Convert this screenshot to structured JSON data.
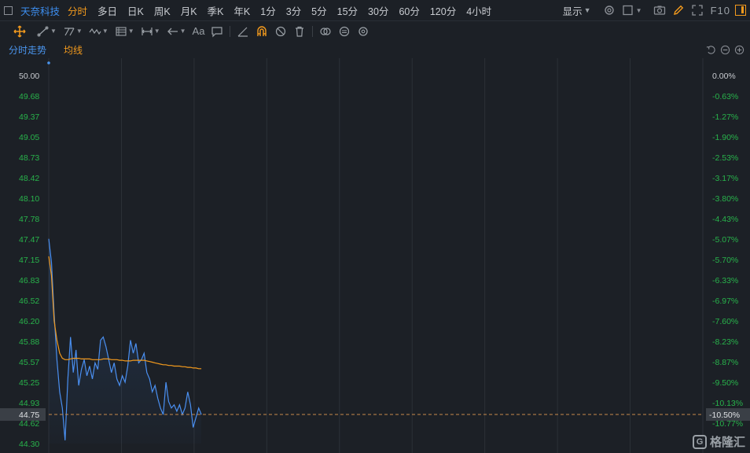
{
  "header": {
    "stock_name": "天奈科技",
    "periods": [
      "分时",
      "多日",
      "日K",
      "周K",
      "月K",
      "季K",
      "年K",
      "1分",
      "3分",
      "5分",
      "15分",
      "30分",
      "60分",
      "120分",
      "4小时"
    ],
    "active_period": "分时",
    "display_label": "显示",
    "f10_label": "F10"
  },
  "toolbar": {
    "text_tool_label": "Aa"
  },
  "chart_header": {
    "tab_timeshare": "分时走势",
    "tab_avg": "均线"
  },
  "colors": {
    "background": "#1c2026",
    "grid": "#2c3138",
    "price_line": "#4a8ff0",
    "avg_line": "#f39a1d",
    "axis_green": "#28b34b",
    "accent": "#f39a1d",
    "current_tag_bg": "#3a3f46"
  },
  "chart_data": {
    "type": "line",
    "title": "",
    "y_left_ticks": [
      "50.00",
      "49.68",
      "49.37",
      "49.05",
      "48.73",
      "48.42",
      "48.10",
      "47.78",
      "47.47",
      "47.15",
      "46.83",
      "46.52",
      "46.20",
      "45.88",
      "45.57",
      "45.25",
      "44.93",
      "44.62",
      "44.30"
    ],
    "y_right_ticks": [
      "0.00%",
      "-0.63%",
      "-1.27%",
      "-1.90%",
      "-2.53%",
      "-3.17%",
      "-3.80%",
      "-4.43%",
      "-5.07%",
      "-5.70%",
      "-6.33%",
      "-6.97%",
      "-7.60%",
      "-8.23%",
      "-8.87%",
      "-9.50%",
      "-10.13%",
      "-10.77%"
    ],
    "ylim": [
      44.3,
      50.0
    ],
    "current_price_label": "44.75",
    "current_pct_label": "-10.50%",
    "current_price": 44.75,
    "session_minutes": 240,
    "x_gridlines": 8,
    "series": [
      {
        "key": "price",
        "values": [
          47.47,
          47.1,
          46.3,
          45.6,
          45.1,
          44.85,
          44.35,
          45.3,
          45.95,
          45.4,
          45.75,
          45.2,
          45.45,
          45.6,
          45.35,
          45.5,
          45.3,
          45.55,
          45.45,
          45.9,
          45.95,
          45.8,
          45.6,
          45.4,
          45.55,
          45.3,
          45.2,
          45.35,
          45.25,
          45.5,
          45.9,
          45.7,
          45.85,
          45.55,
          45.6,
          45.7,
          45.4,
          45.3,
          45.1,
          45.2,
          45.0,
          44.85,
          44.75,
          45.25,
          44.95,
          44.85,
          44.9,
          44.8,
          44.9,
          44.75,
          44.85,
          45.1,
          44.9,
          44.55,
          44.7,
          44.85,
          44.75
        ]
      },
      {
        "key": "avg",
        "values": [
          47.2,
          46.9,
          46.2,
          45.9,
          45.7,
          45.62,
          45.6,
          45.6,
          45.61,
          45.62,
          45.62,
          45.62,
          45.61,
          45.61,
          45.61,
          45.61,
          45.6,
          45.6,
          45.6,
          45.6,
          45.61,
          45.61,
          45.61,
          45.6,
          45.6,
          45.6,
          45.59,
          45.59,
          45.58,
          45.58,
          45.58,
          45.59,
          45.59,
          45.59,
          45.59,
          45.59,
          45.58,
          45.57,
          45.56,
          45.55,
          45.54,
          45.53,
          45.52,
          45.52,
          45.51,
          45.51,
          45.5,
          45.5,
          45.5,
          45.49,
          45.49,
          45.48,
          45.48,
          45.47,
          45.47,
          45.46,
          45.46
        ]
      }
    ]
  }
}
